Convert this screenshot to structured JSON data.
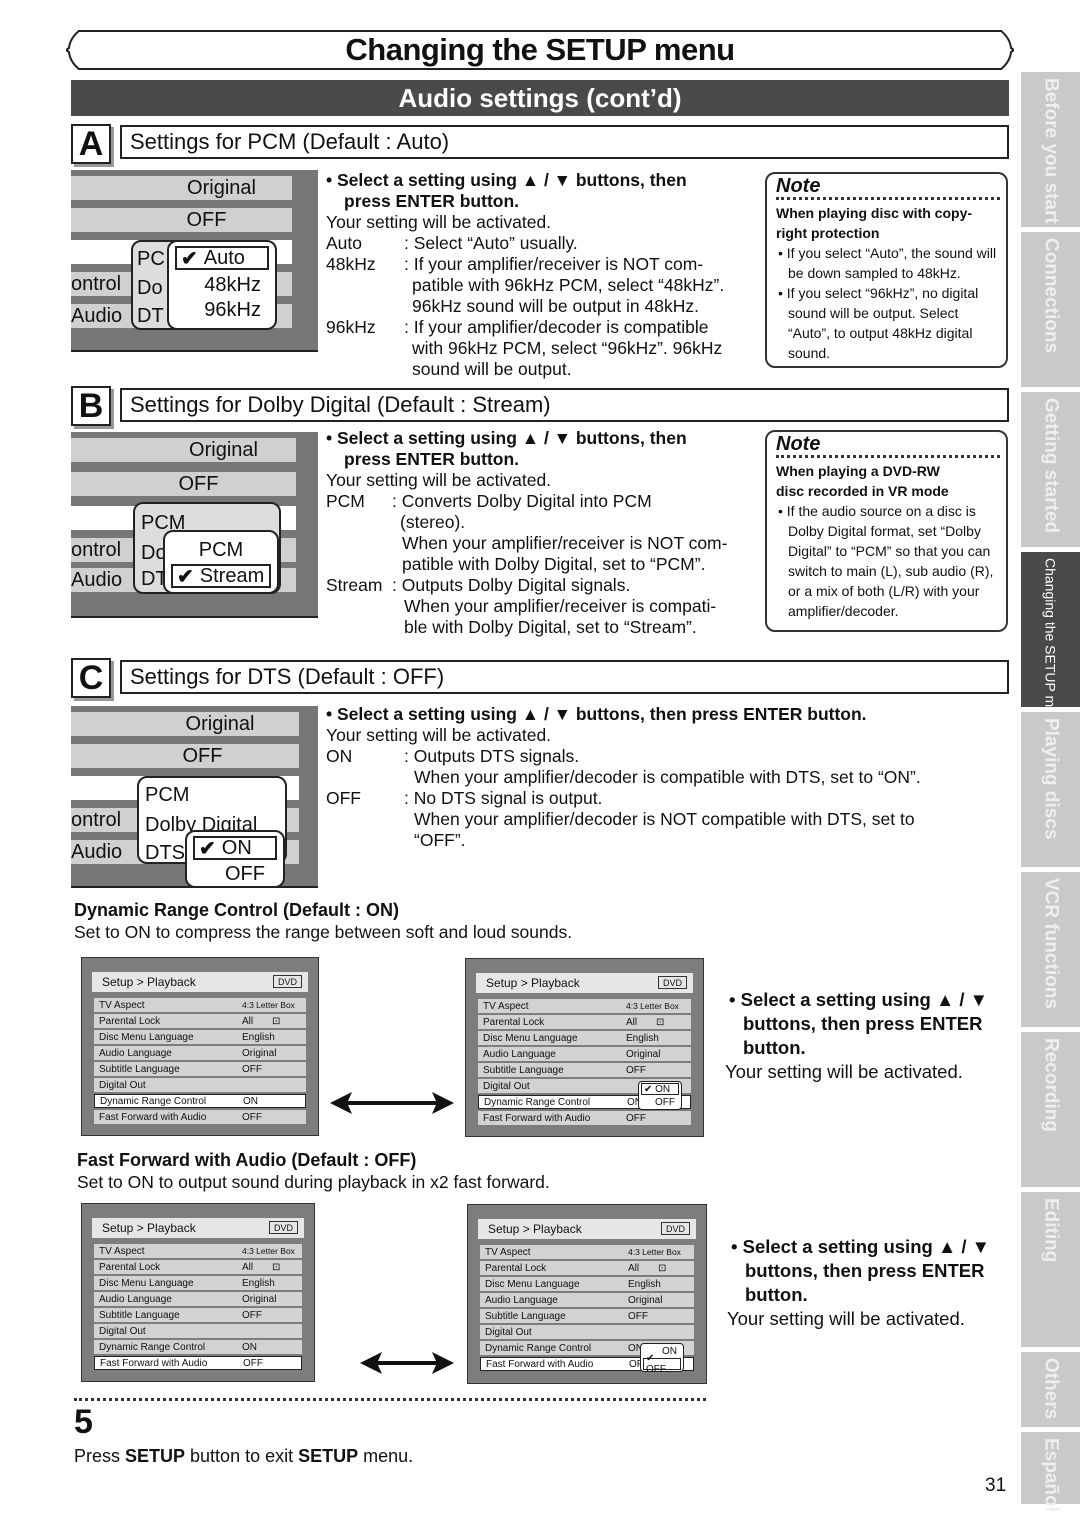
{
  "header": {
    "title": "Changing the SETUP menu",
    "subtitle": "Audio settings (cont’d)"
  },
  "instruction_common": {
    "select_bullet_line1": "• Select a setting using ▲ / ▼ buttons, then",
    "select_bullet_line2": "press ENTER button.",
    "select_bullet_full": "• Select a setting using ▲ / ▼ buttons, then press ENTER button.",
    "activated": "Your setting will be activated."
  },
  "section_a": {
    "letter": "A",
    "title": "Settings for PCM (Default : Auto)",
    "menu": {
      "rows": [
        "Original",
        "OFF",
        "",
        "ontrol",
        "Audio"
      ],
      "left_labels": [
        "PC",
        "Do",
        "DT"
      ],
      "options": [
        "Auto",
        "48kHz",
        "96kHz"
      ],
      "selected": "Auto"
    },
    "definitions": [
      {
        "term": "Auto",
        "lines": [
          ": Select “Auto” usually."
        ]
      },
      {
        "term": "48kHz",
        "lines": [
          ": If your amplifier/receiver is NOT com-",
          "patible with 96kHz PCM, select “48kHz”.",
          "96kHz sound will be output in 48kHz."
        ]
      },
      {
        "term": "96kHz",
        "lines": [
          ": If your amplifier/decoder is compatible",
          "with 96kHz PCM, select “96kHz”. 96kHz",
          "sound will be output."
        ]
      }
    ],
    "note": {
      "title": "Note",
      "heading": [
        "When playing disc with copy-",
        "right protection"
      ],
      "items": [
        "• If you select “Auto”, the sound will be down sampled to 48kHz.",
        "• If you select “96kHz”, no digital sound will be output. Select “Auto”, to output 48kHz digital sound."
      ]
    }
  },
  "section_b": {
    "letter": "B",
    "title": "Settings for Dolby Digital (Default : Stream)",
    "menu": {
      "rows": [
        "Original",
        "OFF",
        "",
        "ontrol",
        "Audio"
      ],
      "left_labels": [
        "PCM",
        "Do",
        "DT"
      ],
      "options": [
        "PCM",
        "Stream"
      ],
      "selected": "Stream"
    },
    "definitions": [
      {
        "term": "PCM",
        "lines": [
          ": Converts Dolby Digital into PCM",
          "(stereo).",
          "When your amplifier/receiver is NOT com-",
          "patible with Dolby Digital, set to “PCM”."
        ]
      },
      {
        "term": "Stream",
        "lines": [
          ": Outputs Dolby Digital signals.",
          "When your amplifier/receiver is compati-",
          "ble with Dolby Digital, set to “Stream”."
        ]
      }
    ],
    "note": {
      "title": "Note",
      "heading": [
        "When playing a DVD-RW",
        "disc recorded in VR mode"
      ],
      "items": [
        "• If the audio source on a disc is Dolby Digital format, set “Dolby Digital” to “PCM” so that you can switch to main (L), sub audio (R), or a mix of both (L/R) with your amplifier/decoder."
      ]
    }
  },
  "section_c": {
    "letter": "C",
    "title": "Settings for DTS (Default : OFF)",
    "menu": {
      "rows": [
        "Original",
        "OFF",
        "",
        "ontrol",
        "Audio"
      ],
      "left_labels": [
        "PCM",
        "Dolby Digital",
        "DTS"
      ],
      "options": [
        "ON",
        "OFF"
      ],
      "selected": "ON"
    },
    "definitions": [
      {
        "term": "ON",
        "lines": [
          ": Outputs DTS signals.",
          "When your amplifier/decoder is compatible with DTS, set to “ON”."
        ]
      },
      {
        "term": "OFF",
        "lines": [
          ": No DTS signal is output.",
          "When your amplifier/decoder is NOT compatible with DTS, set to",
          "“OFF”."
        ]
      }
    ]
  },
  "drc": {
    "title": "Dynamic Range Control (Default : ON)",
    "description": "Set to ON to compress the range between soft and loud sounds.",
    "bullet_lines": [
      "• Select a setting using ▲ / ▼",
      "buttons, then press ENTER",
      "button."
    ],
    "popup_options": [
      "ON",
      "OFF"
    ],
    "popup_selected": "ON"
  },
  "ffa": {
    "title": "Fast Forward with Audio (Default : OFF)",
    "description": "Set to ON to output sound during playback in x2 fast forward.",
    "bullet_lines": [
      "• Select a setting using ▲ / ▼",
      "buttons, then press ENTER",
      "button."
    ],
    "popup_options": [
      "ON",
      "OFF"
    ],
    "popup_selected": "OFF"
  },
  "setup_screen": {
    "breadcrumb": "Setup > Playback",
    "disc_badge": "DVD",
    "rows": [
      {
        "label": "TV Aspect",
        "value": "4:3 Letter Box"
      },
      {
        "label": "Parental Lock",
        "value": "All"
      },
      {
        "label": "Disc Menu Language",
        "value": "English"
      },
      {
        "label": "Audio Language",
        "value": "Original"
      },
      {
        "label": "Subtitle Language",
        "value": "OFF"
      },
      {
        "label": "Digital Out",
        "value": ""
      },
      {
        "label": "Dynamic Range Control",
        "value": "ON"
      },
      {
        "label": "Fast Forward with Audio",
        "value": "OFF"
      }
    ]
  },
  "step": {
    "number": "5",
    "text_parts": [
      "Press ",
      "SETUP",
      " button to exit ",
      "SETUP",
      " menu."
    ]
  },
  "page_number": "31",
  "sidebar_tabs": [
    {
      "label": "Before you start",
      "active": false
    },
    {
      "label": "Connections",
      "active": false
    },
    {
      "label": "Getting started",
      "active": false
    },
    {
      "label": "Changing the SETUP menu",
      "active": true
    },
    {
      "label": "Playing discs",
      "active": false
    },
    {
      "label": "VCR functions",
      "active": false
    },
    {
      "label": "Recording",
      "active": false
    },
    {
      "label": "Editing",
      "active": false
    },
    {
      "label": "Others",
      "active": false
    },
    {
      "label": "Español",
      "active": false
    }
  ],
  "colors": {
    "banner_bg": "#4a4a4a",
    "tab_bg": "#c9c9c9",
    "tab_active_bg": "#4a4a4a",
    "menu_bg": "#777777",
    "menu_row": "#d0d0d0"
  }
}
